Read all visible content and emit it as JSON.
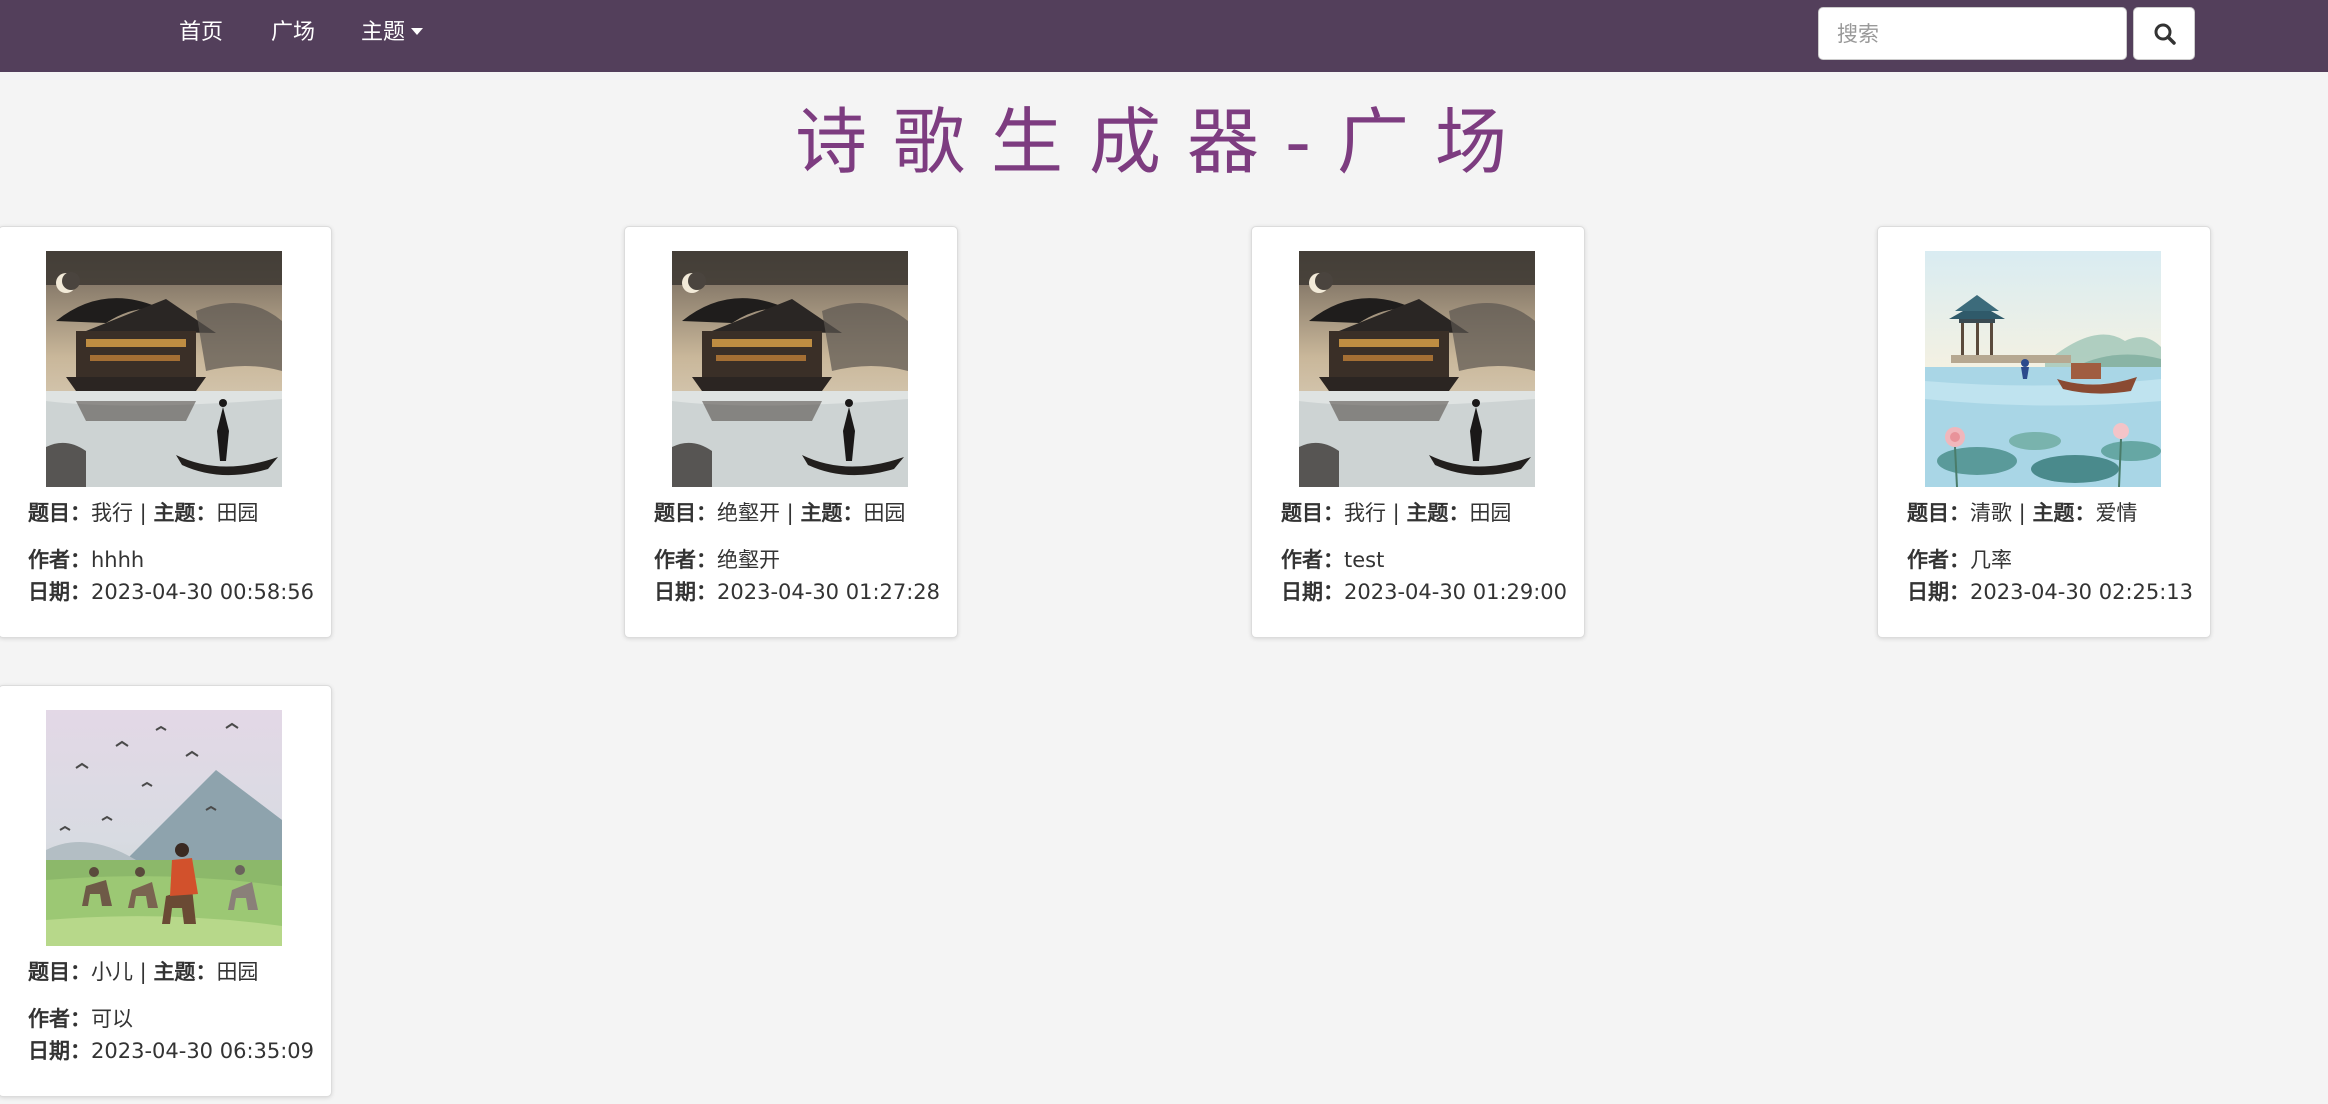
{
  "nav": {
    "home": "首页",
    "square": "广场",
    "theme": "主题"
  },
  "search": {
    "placeholder": "搜索",
    "value": ""
  },
  "page_title": "诗歌生成器-广场",
  "labels": {
    "title": "题目",
    "theme": "主题",
    "author": "作者",
    "date": "日期",
    "colon": "：",
    "sep": " | "
  },
  "cards": [
    {
      "title": "我行",
      "theme": "田园",
      "author": "hhhh",
      "date": "2023-04-30 00:58:56",
      "image": "pavilion-night-boat"
    },
    {
      "title": "绝壑开",
      "theme": "田园",
      "author": "绝壑开",
      "date": "2023-04-30 01:27:28",
      "image": "pavilion-night-boat"
    },
    {
      "title": "我行",
      "theme": "田园",
      "author": "test",
      "date": "2023-04-30 01:29:00",
      "image": "pavilion-night-boat"
    },
    {
      "title": "清歌",
      "theme": "爱情",
      "author": "几率",
      "date": "2023-04-30 02:25:13",
      "image": "lake-pavilion-lotus"
    },
    {
      "title": "小儿",
      "theme": "田园",
      "author": "可以",
      "date": "2023-04-30 06:35:09",
      "image": "riders-mountain-birds"
    }
  ],
  "colors": {
    "navbar": "#533f5b",
    "title": "#7d3c80",
    "background": "#f4f4f4"
  },
  "icons": {
    "search": "search-icon",
    "caret": "caret-down-icon"
  }
}
